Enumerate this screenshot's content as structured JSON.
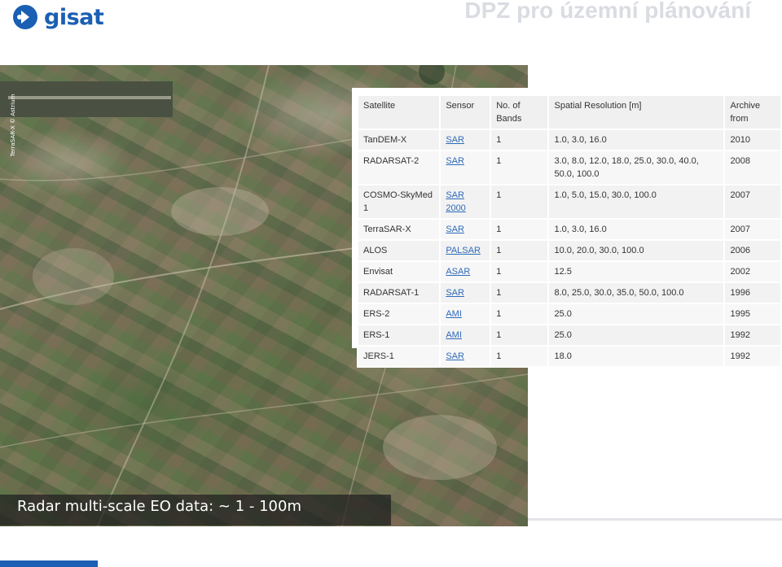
{
  "header": {
    "logo_text": "gisat",
    "title": "DPZ pro územní plánování"
  },
  "image": {
    "credit": "TerraSAR-X © Astrium",
    "caption": "Radar multi-scale EO data: ~ 1 - 100m"
  },
  "table": {
    "headers": {
      "satellite": "Satellite",
      "sensor": "Sensor",
      "bands": "No. of Bands",
      "resolution": "Spatial Resolution [m]",
      "archive": "Archive from"
    },
    "rows": [
      {
        "satellite": "TanDEM-X",
        "sensor": "SAR",
        "bands": "1",
        "resolution": "1.0, 3.0, 16.0",
        "archive": "2010"
      },
      {
        "satellite": "RADARSAT-2",
        "sensor": "SAR",
        "bands": "1",
        "resolution": "3.0, 8.0, 12.0, 18.0, 25.0, 30.0, 40.0, 50.0, 100.0",
        "archive": "2008"
      },
      {
        "satellite": "COSMO-SkyMed 1",
        "sensor": "SAR 2000",
        "bands": "1",
        "resolution": "1.0, 5.0, 15.0, 30.0, 100.0",
        "archive": "2007"
      },
      {
        "satellite": "TerraSAR-X",
        "sensor": "SAR",
        "bands": "1",
        "resolution": "1.0, 3.0, 16.0",
        "archive": "2007"
      },
      {
        "satellite": "ALOS",
        "sensor": "PALSAR",
        "bands": "1",
        "resolution": "10.0, 20.0, 30.0, 100.0",
        "archive": "2006"
      },
      {
        "satellite": "Envisat",
        "sensor": "ASAR",
        "bands": "1",
        "resolution": "12.5",
        "archive": "2002"
      },
      {
        "satellite": "RADARSAT-1",
        "sensor": "SAR",
        "bands": "1",
        "resolution": "8.0, 25.0, 30.0, 35.0, 50.0, 100.0",
        "archive": "1996"
      },
      {
        "satellite": "ERS-2",
        "sensor": "AMI",
        "bands": "1",
        "resolution": "25.0",
        "archive": "1995"
      },
      {
        "satellite": "ERS-1",
        "sensor": "AMI",
        "bands": "1",
        "resolution": "25.0",
        "archive": "1992"
      },
      {
        "satellite": "JERS-1",
        "sensor": "SAR",
        "bands": "1",
        "resolution": "18.0",
        "archive": "1992"
      }
    ]
  },
  "colors": {
    "brand": "#1a5fb4",
    "title": "#d9dce1",
    "link": "#2e6ab8"
  }
}
